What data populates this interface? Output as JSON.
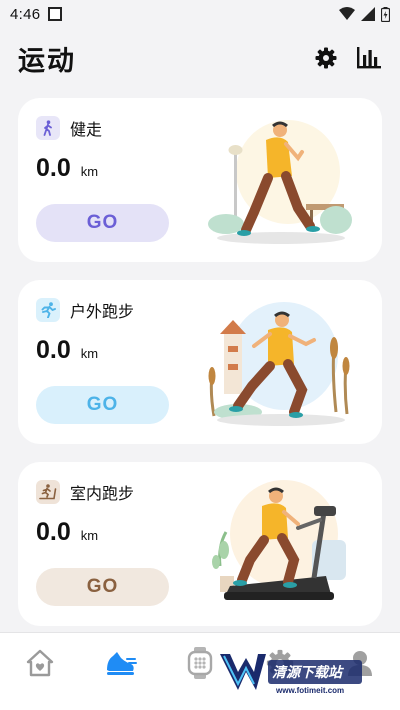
{
  "status_bar": {
    "time": "4:46"
  },
  "header": {
    "title": "运动"
  },
  "cards": [
    {
      "name": "walk",
      "label": "健走",
      "distance": "0.0",
      "unit": "km",
      "button": "GO",
      "accent": "#6b5fd6",
      "button_bg": "#e4e2f7",
      "badge_bg": "#e8e6f8"
    },
    {
      "name": "outdoor-run",
      "label": "户外跑步",
      "distance": "0.0",
      "unit": "km",
      "button": "GO",
      "accent": "#4db3e8",
      "button_bg": "#d9f0fc",
      "badge_bg": "#daf1fc"
    },
    {
      "name": "indoor-run",
      "label": "室内跑步",
      "distance": "0.0",
      "unit": "km",
      "button": "GO",
      "accent": "#8a6140",
      "button_bg": "#f1e8df",
      "badge_bg": "#efe3d8"
    }
  ],
  "bottom_nav": [
    {
      "name": "home",
      "icon": "home-icon",
      "active": false
    },
    {
      "name": "sport",
      "icon": "running-shoe-icon",
      "active": true,
      "color": "#1f8cf5"
    },
    {
      "name": "watch",
      "icon": "watch-icon",
      "active": false
    },
    {
      "name": "settings",
      "icon": "gear-icon",
      "active": false
    },
    {
      "name": "profile",
      "icon": "profile-icon",
      "active": false
    }
  ],
  "watermark": {
    "text": "清源下载站",
    "url": "www.fotimeit.com"
  }
}
